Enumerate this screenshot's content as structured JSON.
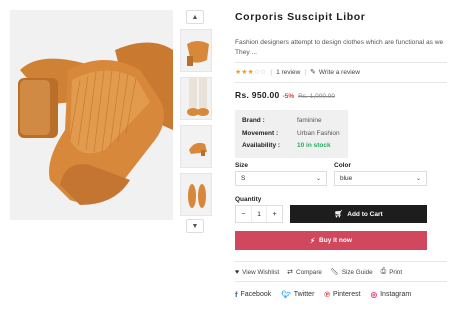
{
  "product": {
    "title": "Corporis Suscipit Libor",
    "description": "Fashion designers attempt to design clothes which are functional as we They ...",
    "rating_stars_filled": 3,
    "rating_stars_total": 5,
    "review_count_label": "1 review",
    "write_review_label": "Write a review",
    "price": "Rs. 950.00",
    "discount": "-5%",
    "old_price": "Rs. 1,000.00"
  },
  "specs": {
    "brand_label": "Brand :",
    "brand_value": "faminine",
    "movement_label": "Movement :",
    "movement_value": "Urban Fashion",
    "availability_label": "Availability :",
    "availability_value": "10 in stock"
  },
  "options": {
    "size_label": "Size",
    "size_value": "S",
    "color_label": "Color",
    "color_value": "blue"
  },
  "purchase": {
    "quantity_label": "Quantity",
    "minus": "−",
    "quantity_value": "1",
    "plus": "+",
    "add_to_cart_label": "Add to Cart",
    "buy_now_label": "Buy it now"
  },
  "actions": {
    "wishlist": "View Wishlist",
    "compare": "Compare",
    "size_guide": "Size Guide",
    "print": "Print"
  },
  "share": {
    "facebook": "Facebook",
    "twitter": "Twitter",
    "pinterest": "Pinterest",
    "instagram": "Instagram"
  },
  "colors": {
    "shoe": "#d8883b",
    "buy_button": "#d1485e",
    "cart_button": "#1d1d1d",
    "in_stock": "#2bab5f",
    "discount": "#e0393e",
    "star": "#e2a23b",
    "twitter": "#1da1f2",
    "pinterest": "#cb2027",
    "instagram": "#e1306c"
  },
  "icons": [
    "chevron-up-icon",
    "chevron-down-icon",
    "star-icon",
    "pencil-icon",
    "cart-icon",
    "lightning-icon",
    "heart-icon",
    "compare-icon",
    "ruler-icon",
    "printer-icon",
    "facebook-icon",
    "twitter-icon",
    "pinterest-icon",
    "instagram-icon"
  ]
}
